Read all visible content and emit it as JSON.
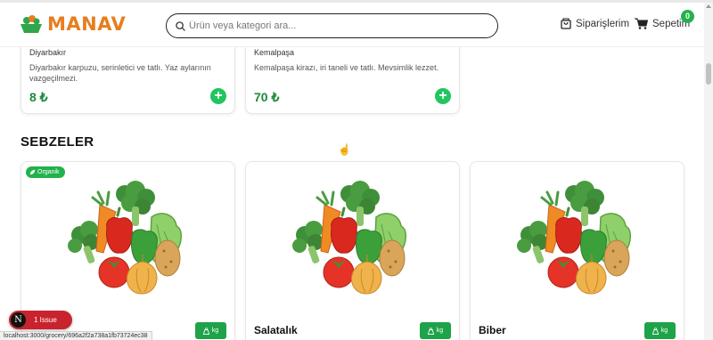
{
  "header": {
    "logo_text": "MANAV",
    "search_placeholder": "Ürün veya kategori ara...",
    "orders_label": "Siparişlerim",
    "cart_label": "Sepetim",
    "cart_count": "0"
  },
  "top_products": [
    {
      "origin": "Diyarbakır",
      "description": "Diyarbakır karpuzu, serinletici ve tatlı. Yaz aylarının vazgeçilmezi.",
      "price": "8 ₺"
    },
    {
      "origin": "Kemalpaşa",
      "description": "Kemalpaşa kirazı, iri taneli ve tatlı. Mevsimlik lezzet.",
      "price": "70 ₺"
    }
  ],
  "section": {
    "title": "SEBZELER"
  },
  "vegetables": [
    {
      "name": "",
      "tag": "Organik",
      "unit": "kg"
    },
    {
      "name": "Salatalık",
      "unit": "kg"
    },
    {
      "name": "Biber",
      "unit": "kg"
    }
  ],
  "devtools": {
    "issue_icon": "N",
    "issue_label": "1 Issue"
  },
  "status_url": "localhost:3000/grocery/696a2f2a738a1fb73724ec38",
  "colors": {
    "brand_orange": "#e87d1e",
    "accent_green": "#22b24c",
    "price_green": "#1e8a3c",
    "issue_red": "#c9232e"
  }
}
